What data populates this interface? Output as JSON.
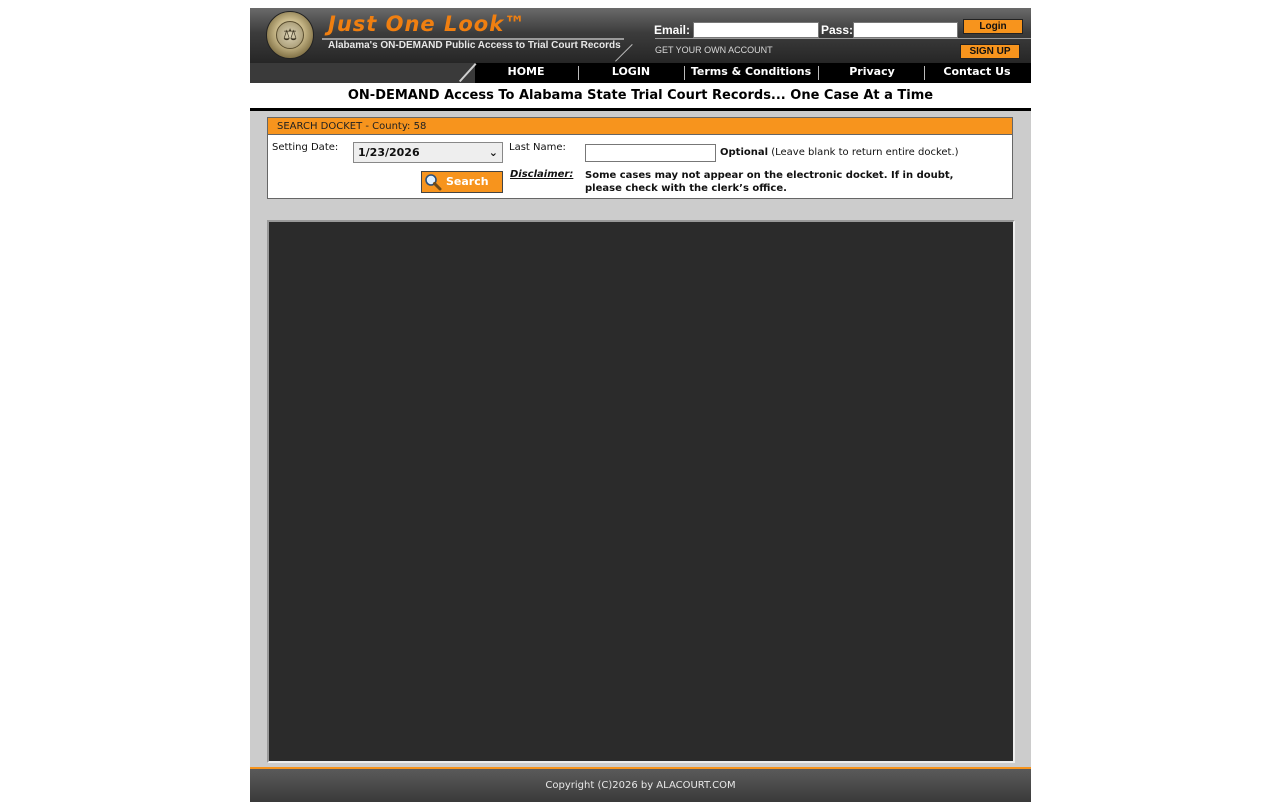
{
  "header": {
    "brand": "Just One Look™",
    "tagline": "Alabama's ON-DEMAND Public Access to Trial Court Records",
    "email_label": "Email:",
    "pass_label": "Pass:",
    "login_button": "Login",
    "get_account": "GET YOUR OWN ACCOUNT",
    "signup_button": "SIGN UP"
  },
  "nav": {
    "items": [
      "HOME",
      "LOGIN",
      "Terms & Conditions",
      "Privacy",
      "Contact Us"
    ]
  },
  "banner": "ON-DEMAND Access To Alabama State Trial Court Records... One Case At a Time",
  "search": {
    "header": "SEARCH DOCKET - County: 58",
    "setting_date_label": "Setting Date:",
    "setting_date_value": "1/23/2026",
    "last_name_label": "Last Name:",
    "last_name_value": "",
    "optional_bold": "Optional",
    "optional_note": "(Leave blank to return entire docket.)",
    "search_button": "Search",
    "disclaimer_label": "Disclaimer:",
    "disclaimer_text": "Some cases may not appear on the electronic docket. If in doubt, please check with the clerk’s office."
  },
  "footer": "Copyright (C)2026 by ALACOURT.COM",
  "colors": {
    "accent": "#f7941d",
    "brand_orange": "#f07f10",
    "panel": "#2b2b2b"
  }
}
